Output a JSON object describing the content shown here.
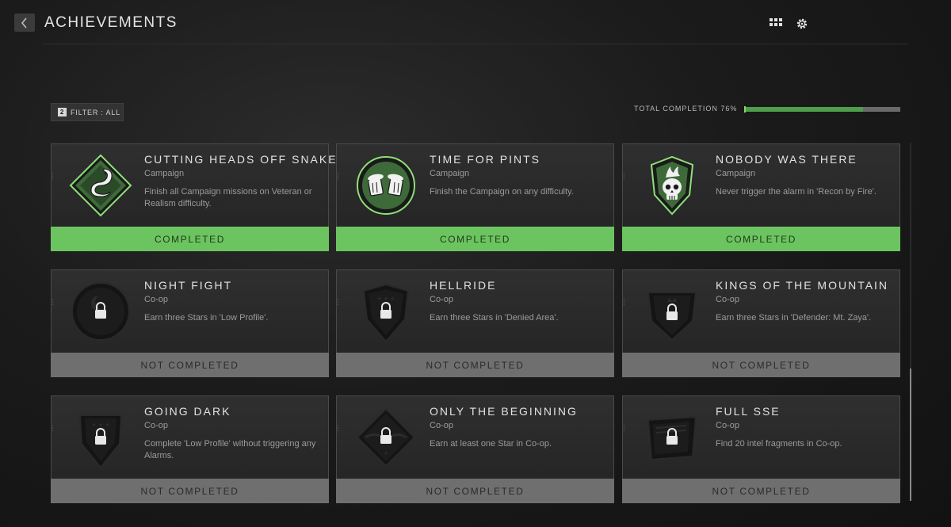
{
  "header": {
    "title": "ACHIEVEMENTS"
  },
  "toolbar": {
    "back_icon": "chevron-left-icon",
    "grid_icon": "grid-view-icon",
    "settings_icon": "gear-icon"
  },
  "filter": {
    "count": "2",
    "label": "FILTER : ALL"
  },
  "completion": {
    "label": "TOTAL COMPLETION",
    "value": "76%",
    "fraction": 0.76,
    "fill_color": "#4f9e4b"
  },
  "colors": {
    "completed": "#6cc460",
    "not_completed": "#6f6f6f"
  },
  "achievements": [
    {
      "name": "CUTTING HEADS OFF SNAKES",
      "category": "Campaign",
      "description": "Finish all Campaign missions on Veteran or Realism difficulty.",
      "status": "COMPLETED",
      "icon": "snake-emblem-icon"
    },
    {
      "name": "TIME FOR PINTS",
      "category": "Campaign",
      "description": "Finish the Campaign on any difficulty.",
      "status": "COMPLETED",
      "icon": "beer-mugs-icon"
    },
    {
      "name": "NOBODY WAS THERE",
      "category": "Campaign",
      "description": "Never trigger the alarm in 'Recon by Fire'.",
      "status": "COMPLETED",
      "icon": "flaming-skull-icon"
    },
    {
      "name": "NIGHT FIGHT",
      "category": "Co-op",
      "description": "Earn three Stars in 'Low Profile'.",
      "status": "NOT COMPLETED",
      "icon": "locked-moon-badge-icon"
    },
    {
      "name": "HELLRIDE",
      "category": "Co-op",
      "description": "Earn three Stars in 'Denied Area'.",
      "status": "NOT COMPLETED",
      "icon": "locked-shield-icon"
    },
    {
      "name": "KINGS OF THE MOUNTAIN",
      "category": "Co-op",
      "description": "Earn three Stars in 'Defender: Mt. Zaya'.",
      "status": "NOT COMPLETED",
      "icon": "locked-crown-shield-icon"
    },
    {
      "name": "GOING DARK",
      "category": "Co-op",
      "description": "Complete 'Low Profile' without triggering any Alarms.",
      "status": "NOT COMPLETED",
      "icon": "locked-shield-icon"
    },
    {
      "name": "ONLY THE BEGINNING",
      "category": "Co-op",
      "description": "Earn at least one Star in Co-op.",
      "status": "NOT COMPLETED",
      "icon": "locked-winged-badge-icon"
    },
    {
      "name": "FULL SSE",
      "category": "Co-op",
      "description": "Find 20 intel fragments in Co-op.",
      "status": "NOT COMPLETED",
      "icon": "locked-intel-icon"
    }
  ]
}
